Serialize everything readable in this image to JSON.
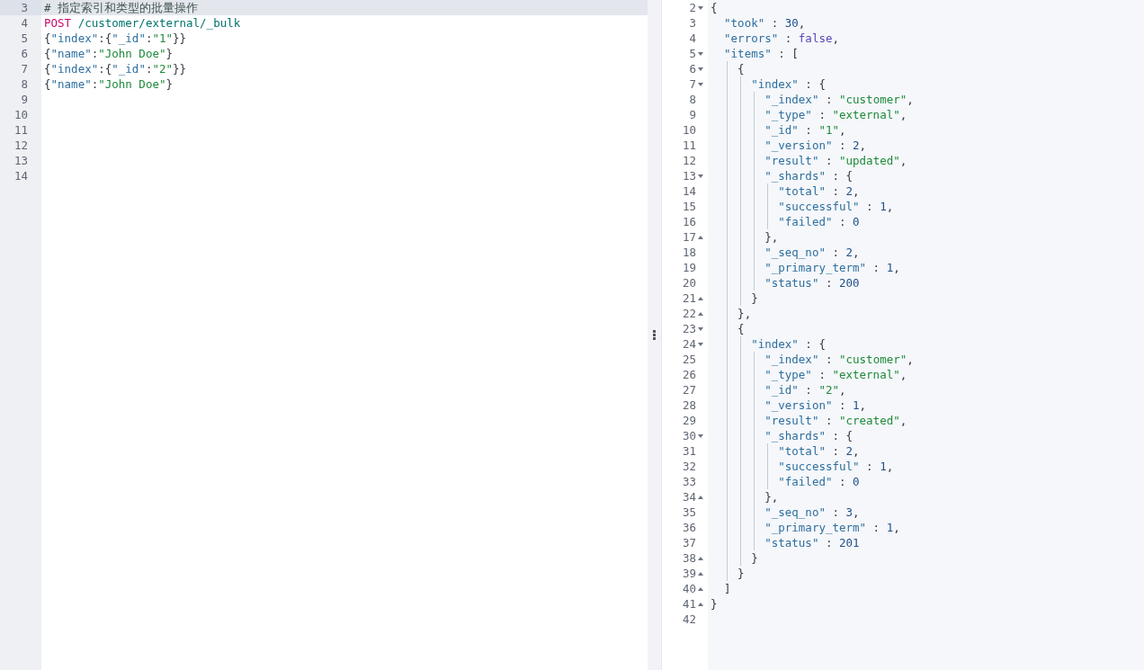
{
  "request_editor": {
    "lines": [
      {
        "number": "3",
        "selected": true,
        "tokens": [
          {
            "kind": "comment",
            "text": "# 指定索引和类型的批量操作"
          }
        ]
      },
      {
        "number": "4",
        "selected": false,
        "tokens": [
          {
            "kind": "method",
            "text": "POST"
          },
          {
            "kind": "path",
            "text": " /customer/external/_bulk"
          }
        ]
      },
      {
        "number": "5",
        "selected": false,
        "tokens": [
          {
            "kind": "punct",
            "text": "{"
          },
          {
            "kind": "key",
            "text": "\"index\""
          },
          {
            "kind": "punct",
            "text": ":{"
          },
          {
            "kind": "key",
            "text": "\"_id\""
          },
          {
            "kind": "punct",
            "text": ":"
          },
          {
            "kind": "string",
            "text": "\"1\""
          },
          {
            "kind": "punct",
            "text": "}}"
          }
        ]
      },
      {
        "number": "6",
        "selected": false,
        "tokens": [
          {
            "kind": "punct",
            "text": "{"
          },
          {
            "kind": "key",
            "text": "\"name\""
          },
          {
            "kind": "punct",
            "text": ":"
          },
          {
            "kind": "string",
            "text": "\"John Doe\""
          },
          {
            "kind": "punct",
            "text": "}"
          }
        ]
      },
      {
        "number": "7",
        "selected": false,
        "tokens": [
          {
            "kind": "punct",
            "text": "{"
          },
          {
            "kind": "key",
            "text": "\"index\""
          },
          {
            "kind": "punct",
            "text": ":{"
          },
          {
            "kind": "key",
            "text": "\"_id\""
          },
          {
            "kind": "punct",
            "text": ":"
          },
          {
            "kind": "string",
            "text": "\"2\""
          },
          {
            "kind": "punct",
            "text": "}}"
          }
        ]
      },
      {
        "number": "8",
        "selected": false,
        "tokens": [
          {
            "kind": "punct",
            "text": "{"
          },
          {
            "kind": "key",
            "text": "\"name\""
          },
          {
            "kind": "punct",
            "text": ":"
          },
          {
            "kind": "string",
            "text": "\"John Doe\""
          },
          {
            "kind": "punct",
            "text": "}"
          }
        ]
      },
      {
        "number": "9",
        "selected": false
      },
      {
        "number": "10",
        "selected": false
      },
      {
        "number": "11",
        "selected": false
      },
      {
        "number": "12",
        "selected": false
      },
      {
        "number": "13",
        "selected": false
      },
      {
        "number": "14",
        "selected": false
      }
    ]
  },
  "response_viewer": {
    "lines": [
      {
        "number": "2",
        "kind": "fold-start",
        "tokens": [
          {
            "kind": "punct",
            "text": "{"
          }
        ]
      },
      {
        "number": "3",
        "kind": "plain",
        "tokens": [
          {
            "kind": "key",
            "text": "  \"took\""
          },
          {
            "kind": "punct",
            "text": " : "
          },
          {
            "kind": "number",
            "text": "30"
          },
          {
            "kind": "punct",
            "text": ","
          }
        ]
      },
      {
        "number": "4",
        "kind": "plain",
        "tokens": [
          {
            "kind": "key",
            "text": "  \"errors\""
          },
          {
            "kind": "punct",
            "text": " : "
          },
          {
            "kind": "boolean",
            "text": "false"
          },
          {
            "kind": "punct",
            "text": ","
          }
        ]
      },
      {
        "number": "5",
        "kind": "fold-start",
        "tokens": [
          {
            "kind": "key",
            "text": "  \"items\""
          },
          {
            "kind": "punct",
            "text": " : ["
          }
        ]
      },
      {
        "number": "6",
        "kind": "fold-start",
        "tokens": [
          {
            "kind": "punct",
            "text": "    {"
          }
        ]
      },
      {
        "number": "7",
        "kind": "fold-start",
        "tokens": [
          {
            "kind": "key",
            "text": "      \"index\""
          },
          {
            "kind": "punct",
            "text": " : {"
          }
        ]
      },
      {
        "number": "8",
        "kind": "plain",
        "tokens": [
          {
            "kind": "key",
            "text": "        \"_index\""
          },
          {
            "kind": "punct",
            "text": " : "
          },
          {
            "kind": "string",
            "text": "\"customer\""
          },
          {
            "kind": "punct",
            "text": ","
          }
        ]
      },
      {
        "number": "9",
        "kind": "plain",
        "tokens": [
          {
            "kind": "key",
            "text": "        \"_type\""
          },
          {
            "kind": "punct",
            "text": " : "
          },
          {
            "kind": "string",
            "text": "\"external\""
          },
          {
            "kind": "punct",
            "text": ","
          }
        ]
      },
      {
        "number": "10",
        "kind": "plain",
        "tokens": [
          {
            "kind": "key",
            "text": "        \"_id\""
          },
          {
            "kind": "punct",
            "text": " : "
          },
          {
            "kind": "string",
            "text": "\"1\""
          },
          {
            "kind": "punct",
            "text": ","
          }
        ]
      },
      {
        "number": "11",
        "kind": "plain",
        "tokens": [
          {
            "kind": "key",
            "text": "        \"_version\""
          },
          {
            "kind": "punct",
            "text": " : "
          },
          {
            "kind": "number",
            "text": "2"
          },
          {
            "kind": "punct",
            "text": ","
          }
        ]
      },
      {
        "number": "12",
        "kind": "plain",
        "tokens": [
          {
            "kind": "key",
            "text": "        \"result\""
          },
          {
            "kind": "punct",
            "text": " : "
          },
          {
            "kind": "string",
            "text": "\"updated\""
          },
          {
            "kind": "punct",
            "text": ","
          }
        ]
      },
      {
        "number": "13",
        "kind": "fold-start",
        "tokens": [
          {
            "kind": "key",
            "text": "        \"_shards\""
          },
          {
            "kind": "punct",
            "text": " : {"
          }
        ]
      },
      {
        "number": "14",
        "kind": "plain",
        "tokens": [
          {
            "kind": "key",
            "text": "          \"total\""
          },
          {
            "kind": "punct",
            "text": " : "
          },
          {
            "kind": "number",
            "text": "2"
          },
          {
            "kind": "punct",
            "text": ","
          }
        ]
      },
      {
        "number": "15",
        "kind": "plain",
        "tokens": [
          {
            "kind": "key",
            "text": "          \"successful\""
          },
          {
            "kind": "punct",
            "text": " : "
          },
          {
            "kind": "number",
            "text": "1"
          },
          {
            "kind": "punct",
            "text": ","
          }
        ]
      },
      {
        "number": "16",
        "kind": "plain",
        "tokens": [
          {
            "kind": "key",
            "text": "          \"failed\""
          },
          {
            "kind": "punct",
            "text": " : "
          },
          {
            "kind": "number",
            "text": "0"
          }
        ]
      },
      {
        "number": "17",
        "kind": "fold-end",
        "tokens": [
          {
            "kind": "punct",
            "text": "        },"
          }
        ]
      },
      {
        "number": "18",
        "kind": "plain",
        "tokens": [
          {
            "kind": "key",
            "text": "        \"_seq_no\""
          },
          {
            "kind": "punct",
            "text": " : "
          },
          {
            "kind": "number",
            "text": "2"
          },
          {
            "kind": "punct",
            "text": ","
          }
        ]
      },
      {
        "number": "19",
        "kind": "plain",
        "tokens": [
          {
            "kind": "key",
            "text": "        \"_primary_term\""
          },
          {
            "kind": "punct",
            "text": " : "
          },
          {
            "kind": "number",
            "text": "1"
          },
          {
            "kind": "punct",
            "text": ","
          }
        ]
      },
      {
        "number": "20",
        "kind": "plain",
        "tokens": [
          {
            "kind": "key",
            "text": "        \"status\""
          },
          {
            "kind": "punct",
            "text": " : "
          },
          {
            "kind": "number",
            "text": "200"
          }
        ]
      },
      {
        "number": "21",
        "kind": "fold-end",
        "tokens": [
          {
            "kind": "punct",
            "text": "      }"
          }
        ]
      },
      {
        "number": "22",
        "kind": "fold-end",
        "tokens": [
          {
            "kind": "punct",
            "text": "    },"
          }
        ]
      },
      {
        "number": "23",
        "kind": "fold-start",
        "tokens": [
          {
            "kind": "punct",
            "text": "    {"
          }
        ]
      },
      {
        "number": "24",
        "kind": "fold-start",
        "tokens": [
          {
            "kind": "key",
            "text": "      \"index\""
          },
          {
            "kind": "punct",
            "text": " : {"
          }
        ]
      },
      {
        "number": "25",
        "kind": "plain",
        "tokens": [
          {
            "kind": "key",
            "text": "        \"_index\""
          },
          {
            "kind": "punct",
            "text": " : "
          },
          {
            "kind": "string",
            "text": "\"customer\""
          },
          {
            "kind": "punct",
            "text": ","
          }
        ]
      },
      {
        "number": "26",
        "kind": "plain",
        "tokens": [
          {
            "kind": "key",
            "text": "        \"_type\""
          },
          {
            "kind": "punct",
            "text": " : "
          },
          {
            "kind": "string",
            "text": "\"external\""
          },
          {
            "kind": "punct",
            "text": ","
          }
        ]
      },
      {
        "number": "27",
        "kind": "plain",
        "tokens": [
          {
            "kind": "key",
            "text": "        \"_id\""
          },
          {
            "kind": "punct",
            "text": " : "
          },
          {
            "kind": "string",
            "text": "\"2\""
          },
          {
            "kind": "punct",
            "text": ","
          }
        ]
      },
      {
        "number": "28",
        "kind": "plain",
        "tokens": [
          {
            "kind": "key",
            "text": "        \"_version\""
          },
          {
            "kind": "punct",
            "text": " : "
          },
          {
            "kind": "number",
            "text": "1"
          },
          {
            "kind": "punct",
            "text": ","
          }
        ]
      },
      {
        "number": "29",
        "kind": "plain",
        "tokens": [
          {
            "kind": "key",
            "text": "        \"result\""
          },
          {
            "kind": "punct",
            "text": " : "
          },
          {
            "kind": "string",
            "text": "\"created\""
          },
          {
            "kind": "punct",
            "text": ","
          }
        ]
      },
      {
        "number": "30",
        "kind": "fold-start",
        "tokens": [
          {
            "kind": "key",
            "text": "        \"_shards\""
          },
          {
            "kind": "punct",
            "text": " : {"
          }
        ]
      },
      {
        "number": "31",
        "kind": "plain",
        "tokens": [
          {
            "kind": "key",
            "text": "          \"total\""
          },
          {
            "kind": "punct",
            "text": " : "
          },
          {
            "kind": "number",
            "text": "2"
          },
          {
            "kind": "punct",
            "text": ","
          }
        ]
      },
      {
        "number": "32",
        "kind": "plain",
        "tokens": [
          {
            "kind": "key",
            "text": "          \"successful\""
          },
          {
            "kind": "punct",
            "text": " : "
          },
          {
            "kind": "number",
            "text": "1"
          },
          {
            "kind": "punct",
            "text": ","
          }
        ]
      },
      {
        "number": "33",
        "kind": "plain",
        "tokens": [
          {
            "kind": "key",
            "text": "          \"failed\""
          },
          {
            "kind": "punct",
            "text": " : "
          },
          {
            "kind": "number",
            "text": "0"
          }
        ]
      },
      {
        "number": "34",
        "kind": "fold-end",
        "tokens": [
          {
            "kind": "punct",
            "text": "        },"
          }
        ]
      },
      {
        "number": "35",
        "kind": "plain",
        "tokens": [
          {
            "kind": "key",
            "text": "        \"_seq_no\""
          },
          {
            "kind": "punct",
            "text": " : "
          },
          {
            "kind": "number",
            "text": "3"
          },
          {
            "kind": "punct",
            "text": ","
          }
        ]
      },
      {
        "number": "36",
        "kind": "plain",
        "tokens": [
          {
            "kind": "key",
            "text": "        \"_primary_term\""
          },
          {
            "kind": "punct",
            "text": " : "
          },
          {
            "kind": "number",
            "text": "1"
          },
          {
            "kind": "punct",
            "text": ","
          }
        ]
      },
      {
        "number": "37",
        "kind": "plain",
        "tokens": [
          {
            "kind": "key",
            "text": "        \"status\""
          },
          {
            "kind": "punct",
            "text": " : "
          },
          {
            "kind": "number",
            "text": "201"
          }
        ]
      },
      {
        "number": "38",
        "kind": "fold-end",
        "tokens": [
          {
            "kind": "punct",
            "text": "      }"
          }
        ]
      },
      {
        "number": "39",
        "kind": "fold-end",
        "tokens": [
          {
            "kind": "punct",
            "text": "    }"
          }
        ]
      },
      {
        "number": "40",
        "kind": "fold-end",
        "tokens": [
          {
            "kind": "punct",
            "text": "  ]"
          }
        ]
      },
      {
        "number": "41",
        "kind": "fold-end",
        "tokens": [
          {
            "kind": "punct",
            "text": "}"
          }
        ]
      },
      {
        "number": "42",
        "kind": "plain"
      }
    ]
  }
}
